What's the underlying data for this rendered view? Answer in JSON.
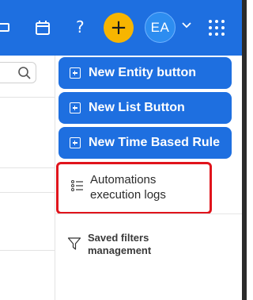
{
  "topbar": {
    "help_label": "?",
    "plus_label": "+",
    "avatar_initials": "EA",
    "icons": [
      "window-icon",
      "calendar-icon",
      "help-icon",
      "plus-icon",
      "chevron-down-icon",
      "apps-grid-icon"
    ],
    "colors": {
      "bar": "#1e6fe0",
      "plus_button": "#f7b500",
      "avatar": "#2d8df0"
    }
  },
  "menu": {
    "buttons": [
      {
        "label": "New Entity button"
      },
      {
        "label": "New List Button"
      },
      {
        "label": "New Time Based Rule"
      }
    ],
    "automations": {
      "line1": "Automations",
      "line2": "execution logs"
    },
    "saved_filters": {
      "line1": "Saved filters",
      "line2": "management"
    },
    "highlight_color": "#e0141c"
  }
}
